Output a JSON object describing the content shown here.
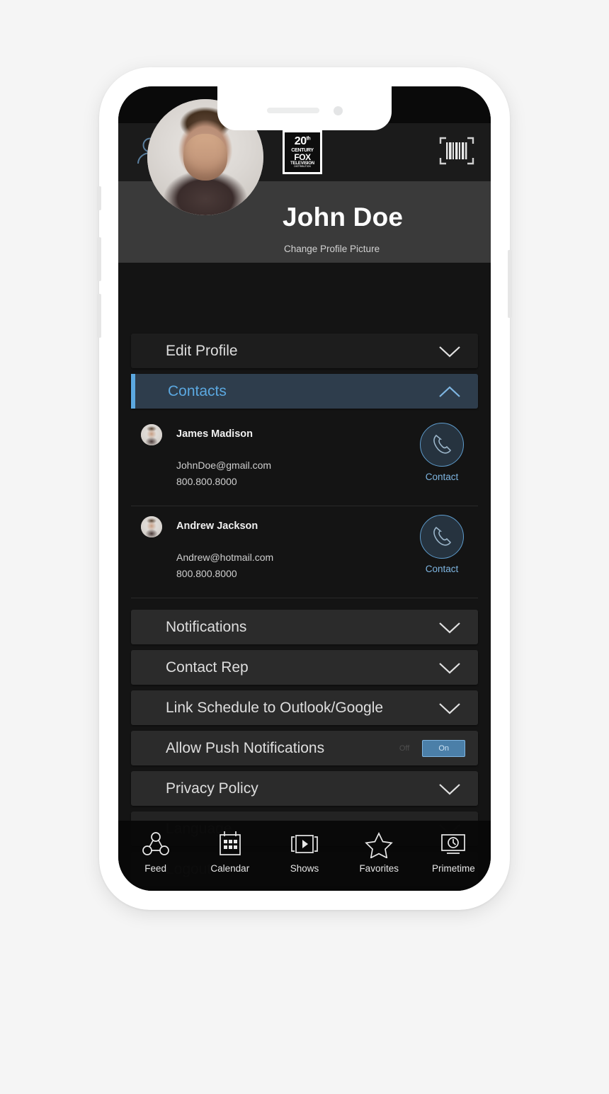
{
  "app_bar": {
    "profile_icon": "person-icon",
    "logo_lines": [
      "20",
      "th",
      "CENTURY",
      "FOX",
      "TELEVISION",
      "DISTRIBUTION"
    ],
    "scan_icon": "barcode-scan-icon"
  },
  "profile": {
    "name": "John Doe",
    "change_picture_label": "Change Profile Picture",
    "avatar_alt": "profile-photo"
  },
  "accordion": {
    "edit_profile": "Edit Profile",
    "contacts": "Contacts",
    "notifications": "Notifications",
    "contact_rep": "Contact Rep",
    "link_schedule": "Link Schedule to Outlook/Google",
    "allow_push": "Allow Push Notifications",
    "privacy_policy": "Privacy Policy",
    "language": "Language",
    "logout": "Logout"
  },
  "toggle": {
    "off_label": "Off",
    "on_label": "On",
    "state": "On"
  },
  "contacts": [
    {
      "name": "James Madison",
      "email": "JohnDoe@gmail.com",
      "phone": "800.800.8000",
      "action_label": "Contact"
    },
    {
      "name": "Andrew Jackson",
      "email": "Andrew@hotmail.com",
      "phone": "800.800.8000",
      "action_label": "Contact"
    }
  ],
  "tabs": [
    {
      "label": "Feed",
      "icon": "network-nodes-icon"
    },
    {
      "label": "Calendar",
      "icon": "calendar-icon"
    },
    {
      "label": "Shows",
      "icon": "film-play-icon"
    },
    {
      "label": "Favorites",
      "icon": "star-icon"
    },
    {
      "label": "Primetime",
      "icon": "tv-clock-icon"
    }
  ],
  "colors": {
    "accent_blue": "#5ba8e0",
    "active_row_bg": "#2e3d4c",
    "screen_bg": "#141414",
    "row_bg": "#2b2b2b",
    "toggle_on_bg": "#4b7fa8"
  }
}
